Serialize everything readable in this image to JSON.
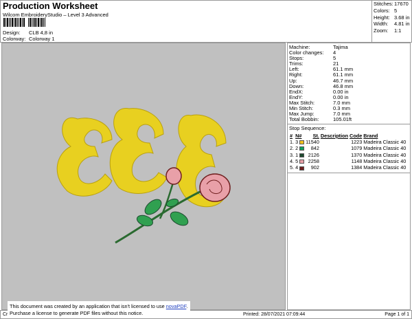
{
  "header": {
    "title": "Production Worksheet",
    "subtitle": "Wilcom EmbroideryStudio – Level 3 Advanced",
    "design_label": "Design:",
    "design_value": "CLB 4,8 in",
    "colorway_label": "Colorway:",
    "colorway_value": "Colorway 1"
  },
  "stats": [
    {
      "label": "Stitches:",
      "value": "17670"
    },
    {
      "label": "Colors:",
      "value": "5"
    },
    {
      "label": "Height:",
      "value": "3.68 in"
    },
    {
      "label": "Width:",
      "value": "4.81 in"
    },
    {
      "label": "Zoom:",
      "value": "1:1"
    }
  ],
  "properties": [
    {
      "label": "Machine:",
      "value": "Tajima"
    },
    {
      "label": "Color changes:",
      "value": "4"
    },
    {
      "label": "Stops:",
      "value": "5"
    },
    {
      "label": "Trims:",
      "value": "21"
    },
    {
      "label": "Left:",
      "value": "61.1 mm"
    },
    {
      "label": "Right:",
      "value": "61.1 mm"
    },
    {
      "label": "Up:",
      "value": "46.7 mm"
    },
    {
      "label": "Down:",
      "value": "46.8 mm"
    },
    {
      "label": "EndX:",
      "value": "0.00 in"
    },
    {
      "label": "EndY:",
      "value": "0.00 in"
    },
    {
      "label": "Max Stitch:",
      "value": "7.0 mm"
    },
    {
      "label": "Min Stitch:",
      "value": "0.3 mm"
    },
    {
      "label": "Max Jump:",
      "value": "7.0 mm"
    },
    {
      "label": "Total Bobbin:",
      "value": "105.01ft"
    }
  ],
  "stop_sequence": {
    "title": "Stop Sequence:",
    "columns": [
      "#",
      "N#",
      "St.",
      "Description",
      "Code",
      "Brand"
    ],
    "rows": [
      {
        "num": "1.",
        "n": "3",
        "color": "#f0c020",
        "st": "11540",
        "desc": "",
        "code": "1223",
        "brand": "Madeira Classic 40"
      },
      {
        "num": "2.",
        "n": "2",
        "color": "#10a060",
        "st": "842",
        "desc": "",
        "code": "1079",
        "brand": "Madeira Classic 40"
      },
      {
        "num": "3.",
        "n": "1",
        "color": "#1e4a30",
        "st": "2126",
        "desc": "",
        "code": "1370",
        "brand": "Madeira Classic 40"
      },
      {
        "num": "4.",
        "n": "5",
        "color": "#e8a0a8",
        "st": "2258",
        "desc": "",
        "code": "1148",
        "brand": "Madeira Classic 40"
      },
      {
        "num": "5.",
        "n": "4",
        "color": "#702020",
        "st": "902",
        "desc": "",
        "code": "1384",
        "brand": "Madeira Classic 40"
      }
    ]
  },
  "footer": {
    "left": "Cr",
    "printed": "Printed: 28/07/2021 07:09:44",
    "page": "Page 1 of 1"
  },
  "notice": {
    "line1": "This document was created by an application that isn't licensed to use ",
    "link": "novaPDF",
    "line1_end": ".",
    "line2": "Purchase a license to generate PDF files without this notice."
  }
}
